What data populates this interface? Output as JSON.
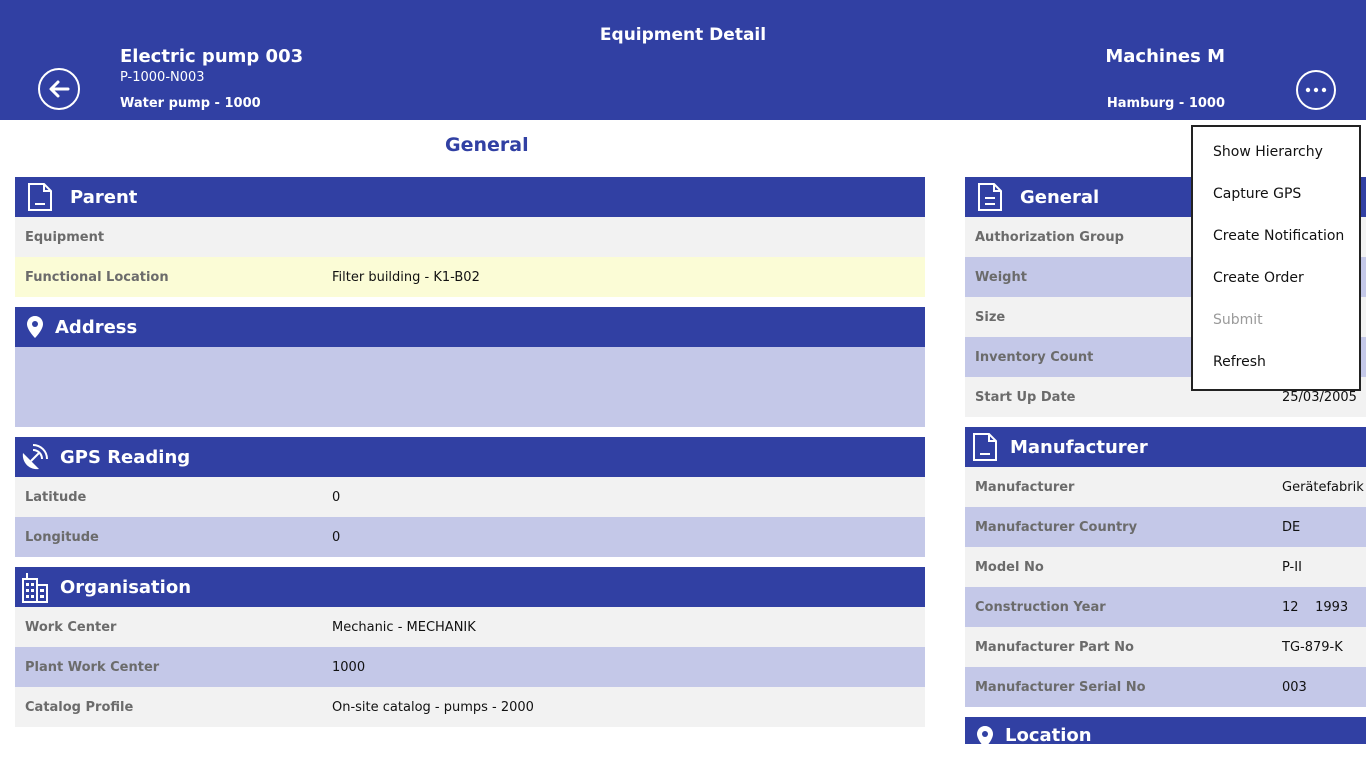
{
  "header": {
    "page_title": "Equipment Detail",
    "equipment_name": "Electric pump 003",
    "equipment_id": "P-1000-N003",
    "equipment_type": "Water pump - 1000",
    "plant_name": "Machines M",
    "plant_location": "Hamburg - 1000"
  },
  "section_heading": "General",
  "left": {
    "parent": {
      "title": "Parent",
      "rows": [
        {
          "label": "Equipment",
          "value": ""
        },
        {
          "label": "Functional Location",
          "value": "Filter building - K1-B02"
        }
      ]
    },
    "address": {
      "title": "Address"
    },
    "gps": {
      "title": "GPS Reading",
      "rows": [
        {
          "label": "Latitude",
          "value": "0"
        },
        {
          "label": "Longitude",
          "value": "0"
        }
      ]
    },
    "organisation": {
      "title": "Organisation",
      "rows": [
        {
          "label": "Work Center",
          "value": "Mechanic - MECHANIK"
        },
        {
          "label": "Plant Work Center",
          "value": "1000"
        },
        {
          "label": "Catalog Profile",
          "value": "On-site catalog - pumps - 2000"
        }
      ]
    }
  },
  "right": {
    "general": {
      "title": "General",
      "rows": [
        {
          "label": "Authorization Group",
          "value": ""
        },
        {
          "label": "Weight",
          "value": ""
        },
        {
          "label": "Size",
          "value": ""
        },
        {
          "label": "Inventory Count",
          "value": ""
        },
        {
          "label": "Start Up Date",
          "value": "25/03/2005"
        }
      ]
    },
    "manufacturer": {
      "title": "Manufacturer",
      "rows": [
        {
          "label": "Manufacturer",
          "value": "Gerätefabrik"
        },
        {
          "label": "Manufacturer Country",
          "value": "DE"
        },
        {
          "label": "Model No",
          "value": "P-II"
        },
        {
          "label": "Construction Year",
          "value": "12    1993"
        },
        {
          "label": "Manufacturer Part No",
          "value": "TG-879-K"
        },
        {
          "label": "Manufacturer Serial No",
          "value": "003"
        }
      ]
    },
    "location": {
      "title": "Location"
    }
  },
  "menu": {
    "items": [
      {
        "label": "Show Hierarchy"
      },
      {
        "label": "Capture GPS"
      },
      {
        "label": "Create Notification"
      },
      {
        "label": "Create Order"
      },
      {
        "label": "Submit"
      },
      {
        "label": "Refresh"
      }
    ]
  },
  "colors": {
    "header_bg": "#3140a3",
    "row_light": "#f2f2f2",
    "row_blue": "#c4c8e8",
    "row_highlight": "#fbfcd6"
  }
}
